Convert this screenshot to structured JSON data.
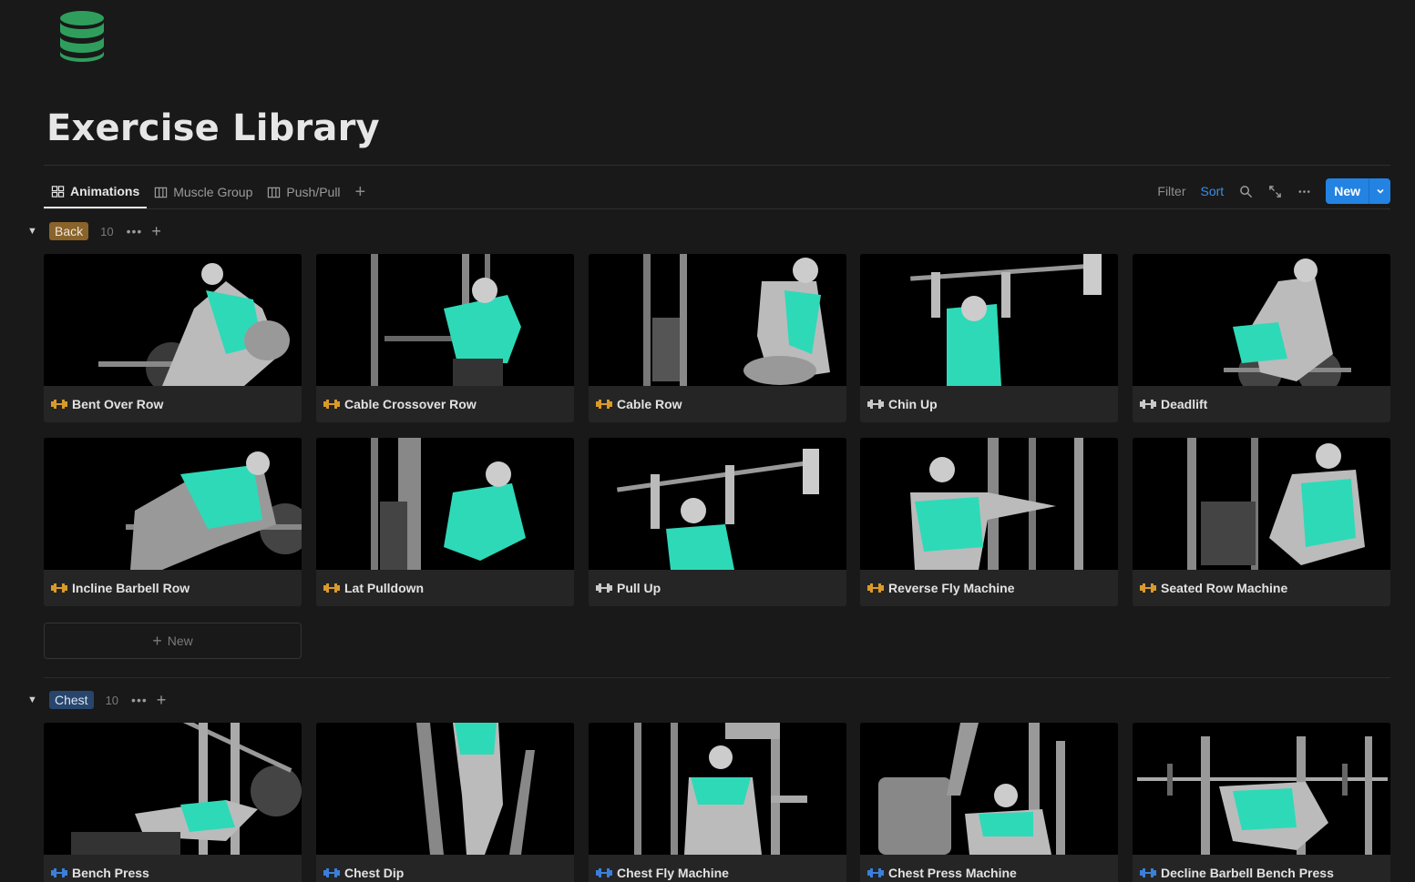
{
  "page": {
    "icon": "database-icon",
    "title": "Exercise Library"
  },
  "tabs": [
    {
      "label": "Animations",
      "icon": "gallery-icon",
      "active": true
    },
    {
      "label": "Muscle Group",
      "icon": "board-icon",
      "active": false
    },
    {
      "label": "Push/Pull",
      "icon": "board-icon",
      "active": false
    }
  ],
  "toolbar": {
    "filter_label": "Filter",
    "sort_label": "Sort",
    "new_label": "New"
  },
  "groups": [
    {
      "tag": "Back",
      "count": "10",
      "cards": [
        {
          "title": "Bent Over Row",
          "icon_color": "#d89a2b"
        },
        {
          "title": "Cable Crossover Row",
          "icon_color": "#d89a2b"
        },
        {
          "title": "Cable Row",
          "icon_color": "#d89a2b"
        },
        {
          "title": "Chin Up",
          "icon_color": "#c9c9c9"
        },
        {
          "title": "Deadlift",
          "icon_color": "#c9c9c9"
        },
        {
          "title": "Incline Barbell Row",
          "icon_color": "#d89a2b"
        },
        {
          "title": "Lat Pulldown",
          "icon_color": "#d89a2b"
        },
        {
          "title": "Pull Up",
          "icon_color": "#c9c9c9"
        },
        {
          "title": "Reverse Fly Machine",
          "icon_color": "#d89a2b"
        },
        {
          "title": "Seated Row Machine",
          "icon_color": "#d89a2b"
        }
      ],
      "new_label": "New"
    },
    {
      "tag": "Chest",
      "count": "10",
      "cards": [
        {
          "title": "Bench Press",
          "icon_color": "#3b7fd9"
        },
        {
          "title": "Chest Dip",
          "icon_color": "#3b7fd9"
        },
        {
          "title": "Chest Fly Machine",
          "icon_color": "#3b7fd9"
        },
        {
          "title": "Chest Press Machine",
          "icon_color": "#3b7fd9"
        },
        {
          "title": "Decline Barbell Bench Press",
          "icon_color": "#3b7fd9"
        }
      ]
    }
  ],
  "colors": {
    "accent": "#2383e2",
    "muscle_highlight": "#2ed9b8",
    "back_tag": "#89632a",
    "chest_tag": "#28456c"
  }
}
